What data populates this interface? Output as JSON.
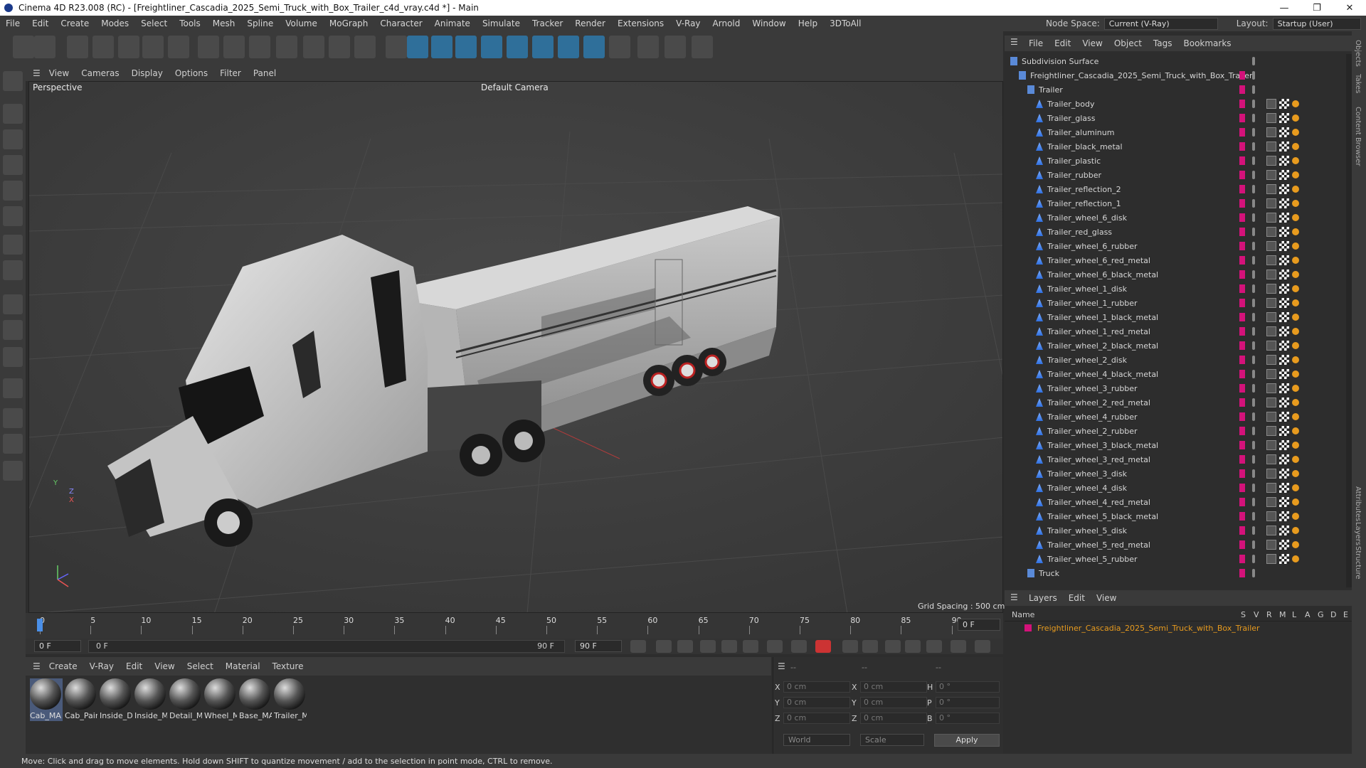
{
  "window": {
    "title": "Cinema 4D R23.008 (RC) - [Freightliner_Cascadia_2025_Semi_Truck_with_Box_Trailer_c4d_vray.c4d *] - Main",
    "minimize": "—",
    "maximize": "❐",
    "close": "✕"
  },
  "menu": {
    "items": [
      "File",
      "Edit",
      "Create",
      "Modes",
      "Select",
      "Tools",
      "Mesh",
      "Spline",
      "Volume",
      "MoGraph",
      "Character",
      "Animate",
      "Simulate",
      "Tracker",
      "Render",
      "Extensions",
      "V-Ray",
      "Arnold",
      "Window",
      "Help",
      "3DToAll"
    ],
    "node_space_label": "Node Space:",
    "node_space_value": "Current (V-Ray)",
    "layout_label": "Layout:",
    "layout_value": "Startup (User)"
  },
  "viewport": {
    "menu": [
      "View",
      "Cameras",
      "Display",
      "Options",
      "Filter",
      "Panel"
    ],
    "label": "Perspective",
    "camera": "Default Camera",
    "grid_spacing": "Grid Spacing : 500 cm",
    "axis_y": "Y",
    "axis_z": "Z",
    "axis_x": "X"
  },
  "timeline": {
    "ticks": [
      "0",
      "5",
      "10",
      "15",
      "20",
      "25",
      "30",
      "35",
      "40",
      "45",
      "50",
      "55",
      "60",
      "65",
      "70",
      "75",
      "80",
      "85",
      "90"
    ],
    "current_frame": "0 F",
    "start_frame": "0 F",
    "range_start": "0 F",
    "range_end": "90 F",
    "end_frame": "90 F"
  },
  "materials": {
    "menu": [
      "Create",
      "V-Ray",
      "Edit",
      "View",
      "Select",
      "Material",
      "Texture"
    ],
    "items": [
      "Cab_MA",
      "Cab_Pair",
      "Inside_D",
      "Inside_M",
      "Detail_M",
      "Wheel_M",
      "Base_MA",
      "Trailer_M"
    ]
  },
  "coords": {
    "header1": "--",
    "header2": "--",
    "header3": "--",
    "x_label": "X",
    "y_label": "Y",
    "z_label": "Z",
    "x2_label": "X",
    "y2_label": "Y",
    "z2_label": "Z",
    "h_label": "H",
    "p_label": "P",
    "b_label": "B",
    "x_val": "0 cm",
    "y_val": "0 cm",
    "z_val": "0 cm",
    "x2_val": "0 cm",
    "y2_val": "0 cm",
    "z2_val": "0 cm",
    "h_val": "0 °",
    "p_val": "0 °",
    "b_val": "0 °",
    "world": "World",
    "scale": "Scale",
    "apply": "Apply"
  },
  "status": "Move: Click and drag to move elements. Hold down SHIFT to quantize movement / add to the selection in point mode, CTRL to remove.",
  "objects": {
    "menu": [
      "File",
      "Edit",
      "View",
      "Object",
      "Tags",
      "Bookmarks"
    ],
    "root": "Subdivision Surface",
    "model": "Freightliner_Cascadia_2025_Semi_Truck_with_Box_Trailer",
    "group": "Trailer",
    "children": [
      "Trailer_body",
      "Trailer_glass",
      "Trailer_aluminum",
      "Trailer_black_metal",
      "Trailer_plastic",
      "Trailer_rubber",
      "Trailer_reflection_2",
      "Trailer_reflection_1",
      "Trailer_wheel_6_disk",
      "Trailer_red_glass",
      "Trailer_wheel_6_rubber",
      "Trailer_wheel_6_red_metal",
      "Trailer_wheel_6_black_metal",
      "Trailer_wheel_1_disk",
      "Trailer_wheel_1_rubber",
      "Trailer_wheel_1_black_metal",
      "Trailer_wheel_1_red_metal",
      "Trailer_wheel_2_black_metal",
      "Trailer_wheel_2_disk",
      "Trailer_wheel_4_black_metal",
      "Trailer_wheel_3_rubber",
      "Trailer_wheel_2_red_metal",
      "Trailer_wheel_4_rubber",
      "Trailer_wheel_2_rubber",
      "Trailer_wheel_3_black_metal",
      "Trailer_wheel_3_red_metal",
      "Trailer_wheel_3_disk",
      "Trailer_wheel_4_disk",
      "Trailer_wheel_4_red_metal",
      "Trailer_wheel_5_black_metal",
      "Trailer_wheel_5_disk",
      "Trailer_wheel_5_red_metal",
      "Trailer_wheel_5_rubber"
    ],
    "group2": "Truck"
  },
  "layers": {
    "menu": [
      "Layers",
      "Edit",
      "View"
    ],
    "name_header": "Name",
    "col_headers": [
      "S",
      "V",
      "R",
      "M",
      "L",
      "A",
      "G",
      "D",
      "E"
    ],
    "layer_name": "Freightliner_Cascadia_2025_Semi_Truck_with_Box_Trailer"
  },
  "side_tabs": [
    "Objects",
    "Takes",
    "Content Browser",
    "Attributes",
    "Layers",
    "Structure"
  ],
  "colors": {
    "accent": "#d4127a",
    "highlight": "#e89b1e"
  }
}
